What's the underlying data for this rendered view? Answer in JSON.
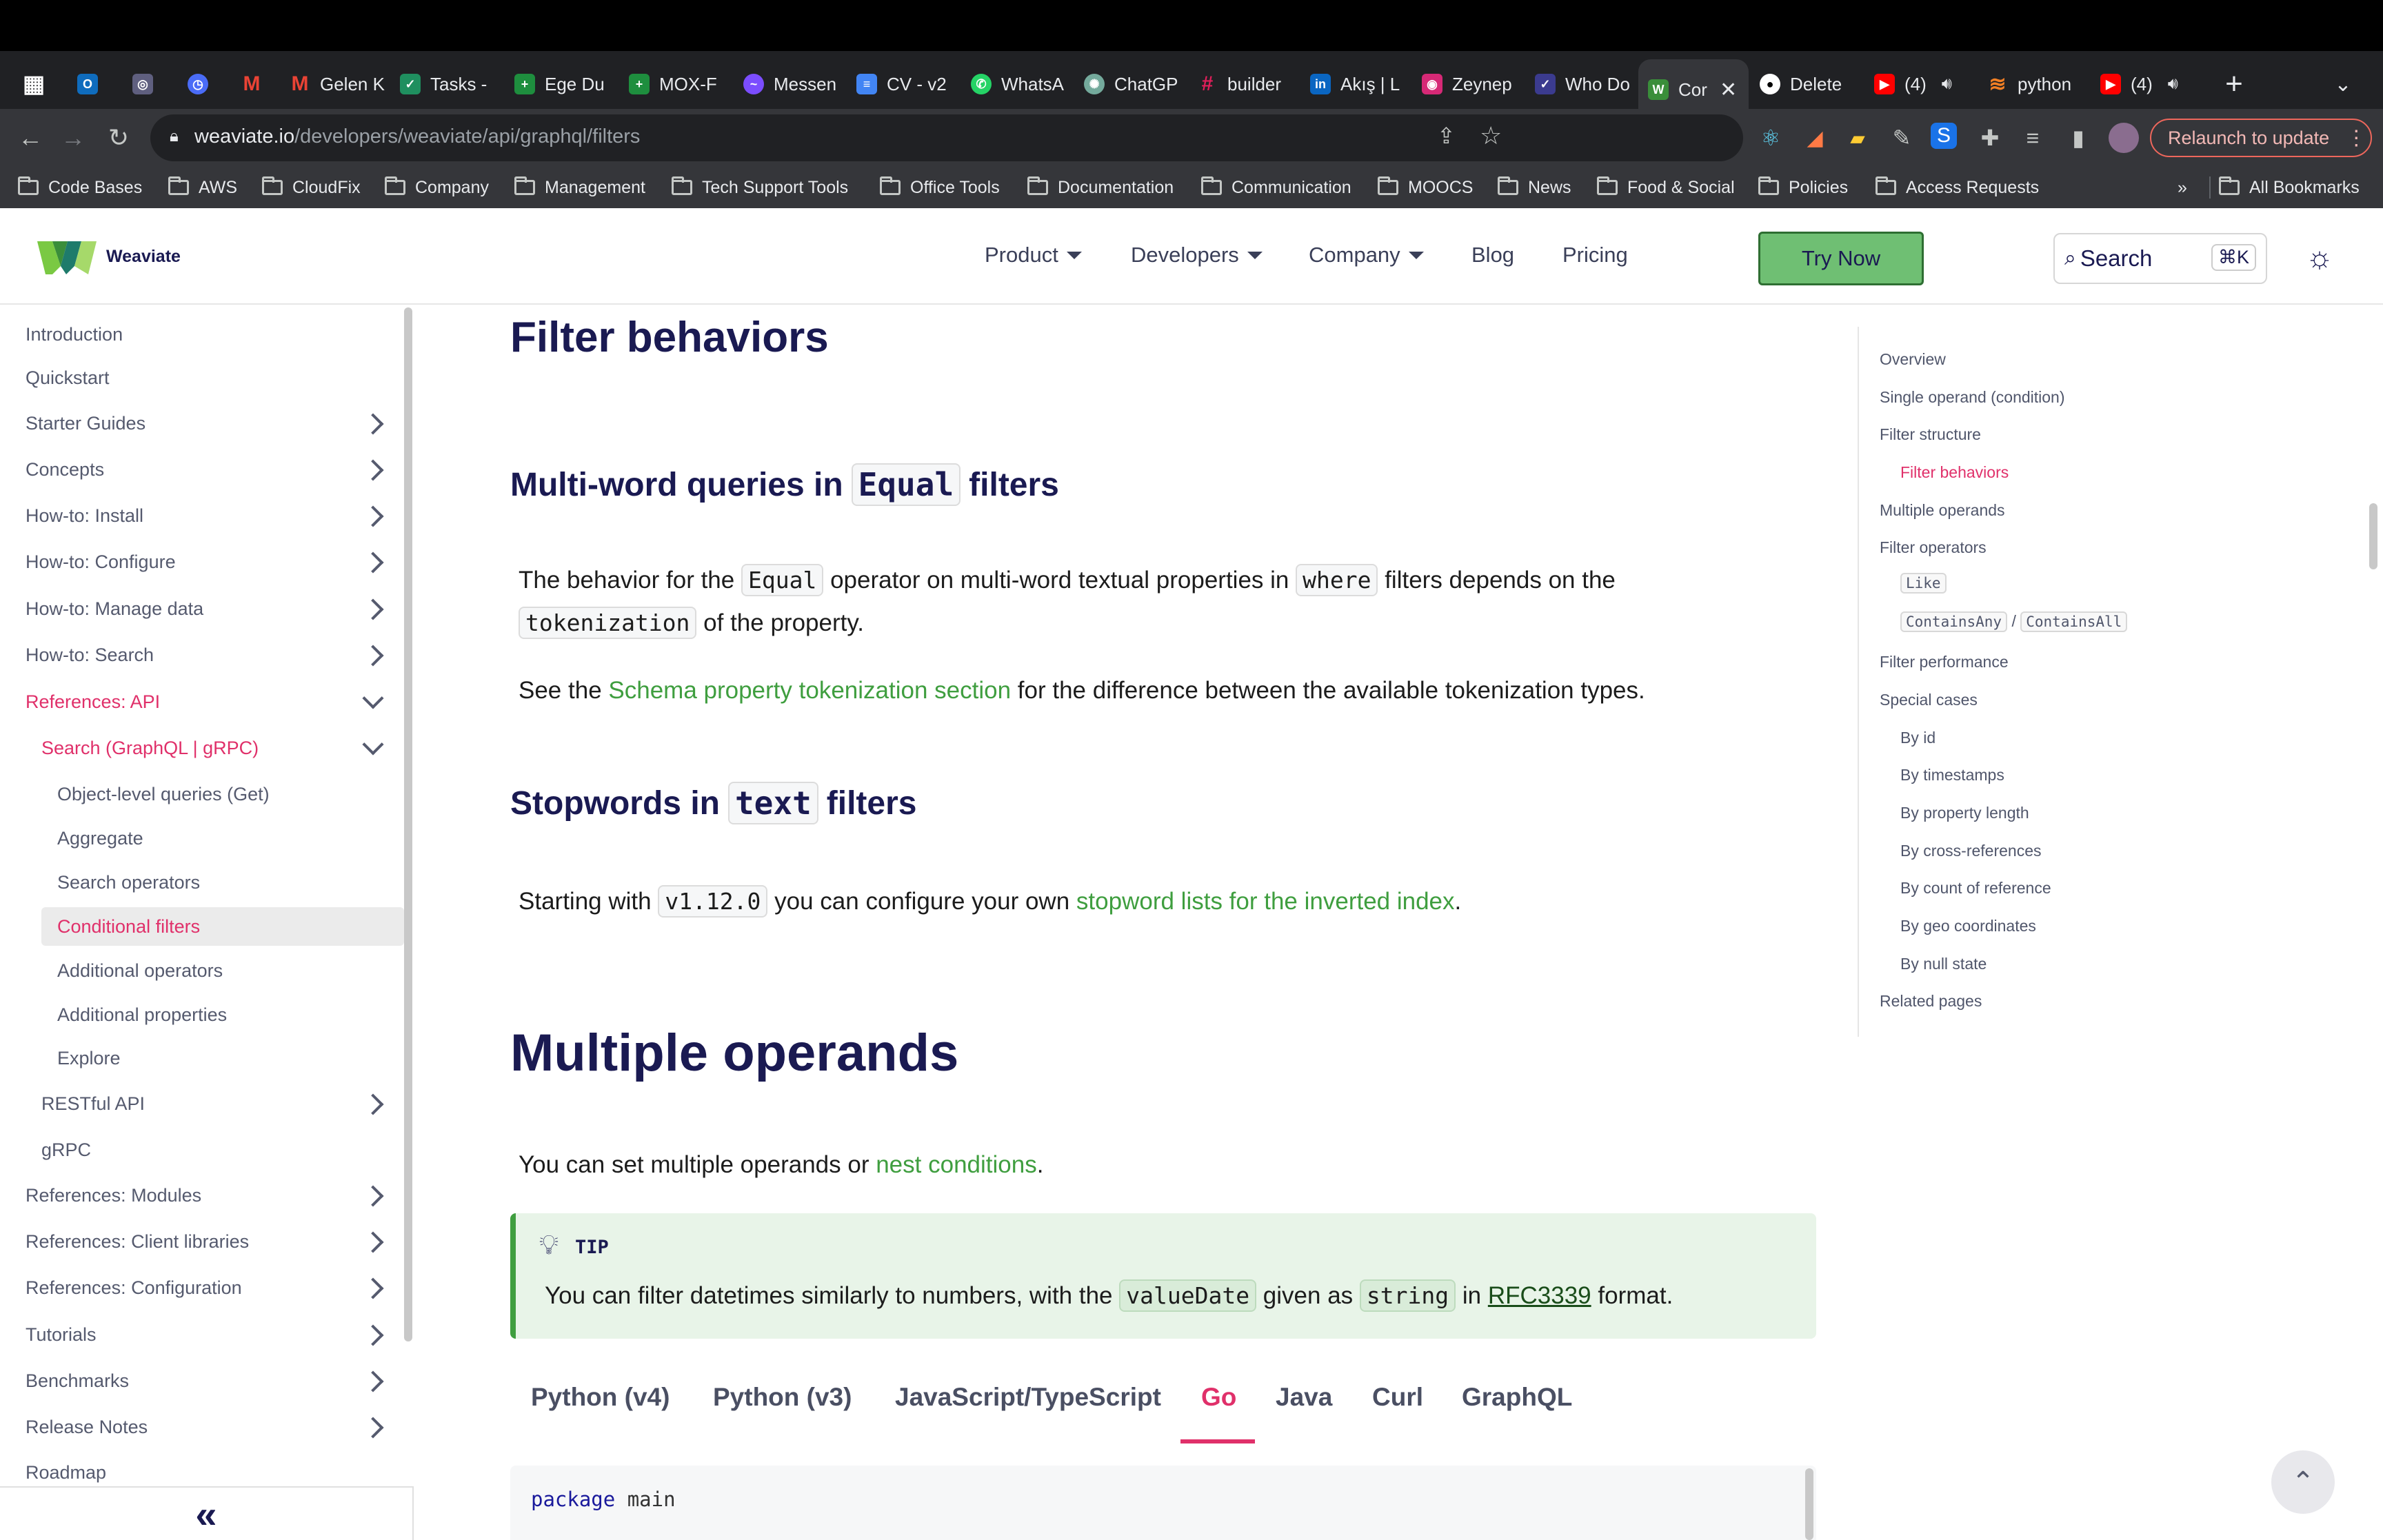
{
  "browser": {
    "tabs": [
      {
        "label": "",
        "icon": "apps-icon",
        "color": "#e8eaed"
      },
      {
        "label": "",
        "icon": "outlook-icon",
        "color": "#0f6cbd"
      },
      {
        "label": "",
        "icon": "app-icon",
        "color": "#5f5f7f"
      },
      {
        "label": "",
        "icon": "clock-icon",
        "color": "#4a6cf7"
      },
      {
        "label": "",
        "icon": "gmail-icon",
        "color": "#ea4335"
      },
      {
        "label": "Gelen K",
        "icon": "gmail-icon",
        "color": "#ea4335"
      },
      {
        "label": "Tasks -",
        "icon": "tasks-icon",
        "color": "#1f8f5f"
      },
      {
        "label": "Ege Du",
        "icon": "sheets-icon",
        "color": "#1e8e3e"
      },
      {
        "label": "MOX-F",
        "icon": "sheets-icon",
        "color": "#1e8e3e"
      },
      {
        "label": "Messen",
        "icon": "messenger-icon",
        "color": "#7b4dff"
      },
      {
        "label": "CV - v2",
        "icon": "docs-icon",
        "color": "#4285f4"
      },
      {
        "label": "WhatsA",
        "icon": "whatsapp-icon",
        "color": "#25d366"
      },
      {
        "label": "ChatGP",
        "icon": "chatgpt-icon",
        "color": "#74aa9c"
      },
      {
        "label": "builder",
        "icon": "slack-icon",
        "color": "#e01e5a"
      },
      {
        "label": "Akış | L",
        "icon": "linkedin-icon",
        "color": "#0a66c2"
      },
      {
        "label": "Zeynep",
        "icon": "instagram-icon",
        "color": "#d62976"
      },
      {
        "label": "Who Do",
        "icon": "app-icon",
        "color": "#3b3b8f"
      },
      {
        "label": "Cor",
        "icon": "weaviate-icon",
        "color": "#3a8e3a"
      },
      {
        "label": "Delete",
        "icon": "github-icon",
        "color": "#ffffff"
      },
      {
        "label": "(4)",
        "icon": "youtube-icon",
        "color": "#ff0000"
      },
      {
        "label": "python",
        "icon": "app-icon",
        "color": "#f48024"
      },
      {
        "label": "(4)",
        "icon": "youtube-icon",
        "color": "#ff0000"
      }
    ],
    "url_host": "weaviate.io",
    "url_path": "/developers/weaviate/api/graphql/filters",
    "relaunch_label": "Relaunch to update",
    "bookmarks": [
      "Code Bases",
      "AWS",
      "CloudFix",
      "Company",
      "Management",
      "Tech Support Tools",
      "Office Tools",
      "Documentation",
      "Communication",
      "MOOCS",
      "News",
      "Food & Social",
      "Policies",
      "Access Requests"
    ],
    "bookmarks_overflow": "»",
    "all_bookmarks": "All Bookmarks"
  },
  "site": {
    "brand": "Weaviate",
    "nav": [
      "Product",
      "Developers",
      "Company",
      "Blog",
      "Pricing"
    ],
    "try_now": "Try Now",
    "search_label": "Search",
    "search_shortcut": "⌘K"
  },
  "sidebar": {
    "items": [
      {
        "label": "Introduction"
      },
      {
        "label": "Quickstart"
      },
      {
        "label": "Starter Guides"
      },
      {
        "label": "Concepts"
      },
      {
        "label": "How-to: Install"
      },
      {
        "label": "How-to: Configure"
      },
      {
        "label": "How-to: Manage data"
      },
      {
        "label": "How-to: Search"
      },
      {
        "label": "References: API"
      },
      {
        "label": "Search (GraphQL | gRPC)"
      },
      {
        "label": "Object-level queries (Get)"
      },
      {
        "label": "Aggregate"
      },
      {
        "label": "Search operators"
      },
      {
        "label": "Conditional filters"
      },
      {
        "label": "Additional operators"
      },
      {
        "label": "Additional properties"
      },
      {
        "label": "Explore"
      },
      {
        "label": "RESTful API"
      },
      {
        "label": "gRPC"
      },
      {
        "label": "References: Modules"
      },
      {
        "label": "References: Client libraries"
      },
      {
        "label": "References: Configuration"
      },
      {
        "label": "Tutorials"
      },
      {
        "label": "Benchmarks"
      },
      {
        "label": "Release Notes"
      },
      {
        "label": "Roadmap"
      }
    ],
    "collapse_label": "«"
  },
  "content": {
    "filter_behaviors_heading": "Filter behaviors",
    "multiword": {
      "heading_pre": "Multi-word queries in",
      "heading_code": "Equal",
      "heading_post": "filters",
      "p1_a": "The behavior for the",
      "p1_code1": "Equal",
      "p1_b": "operator on multi-word textual properties in",
      "p1_code2": "where",
      "p1_c": "filters depends on the",
      "p1_code3": "tokenization",
      "p1_d": "of the property.",
      "p2_a": "See the",
      "p2_link": "Schema property tokenization section",
      "p2_b": "for the difference between the available tokenization types."
    },
    "stopwords": {
      "heading_pre": "Stopwords in",
      "heading_code": "text",
      "heading_post": "filters",
      "p_a": "Starting with",
      "p_code": "v1.12.0",
      "p_b": "you can configure your own",
      "p_link": "stopword lists for the inverted index",
      "p_c": "."
    },
    "multiple_operands_heading": "Multiple operands",
    "mo_p_a": "You can set multiple operands or",
    "mo_p_link": "nest conditions",
    "mo_p_b": ".",
    "tip": {
      "title": "TIP",
      "a": "You can filter datetimes similarly to numbers, with the",
      "code1": "valueDate",
      "b": "given as",
      "code2": "string",
      "c": "in",
      "link": "RFC3339",
      "d": "format."
    },
    "code_tabs": [
      "Python (v4)",
      "Python (v3)",
      "JavaScript/TypeScript",
      "Go",
      "Java",
      "Curl",
      "GraphQL"
    ],
    "active_tab": "Go",
    "code_line_kw": "package",
    "code_line_rest": "main"
  },
  "toc": {
    "items": [
      "Overview",
      "Single operand (condition)",
      "Filter structure",
      "Filter behaviors",
      "Multiple operands",
      "Filter operators",
      "Like",
      "ContainsAny",
      "/",
      "ContainsAll",
      "Filter performance",
      "Special cases",
      "By id",
      "By timestamps",
      "By property length",
      "By cross-references",
      "By count of reference",
      "By geo coordinates",
      "By null state",
      "Related pages"
    ]
  },
  "colors": {
    "accent_pink": "#e0306a",
    "link_green": "#3f9e3f",
    "heading_navy": "#1a1a52",
    "try_now_bg": "#6fbf73"
  }
}
